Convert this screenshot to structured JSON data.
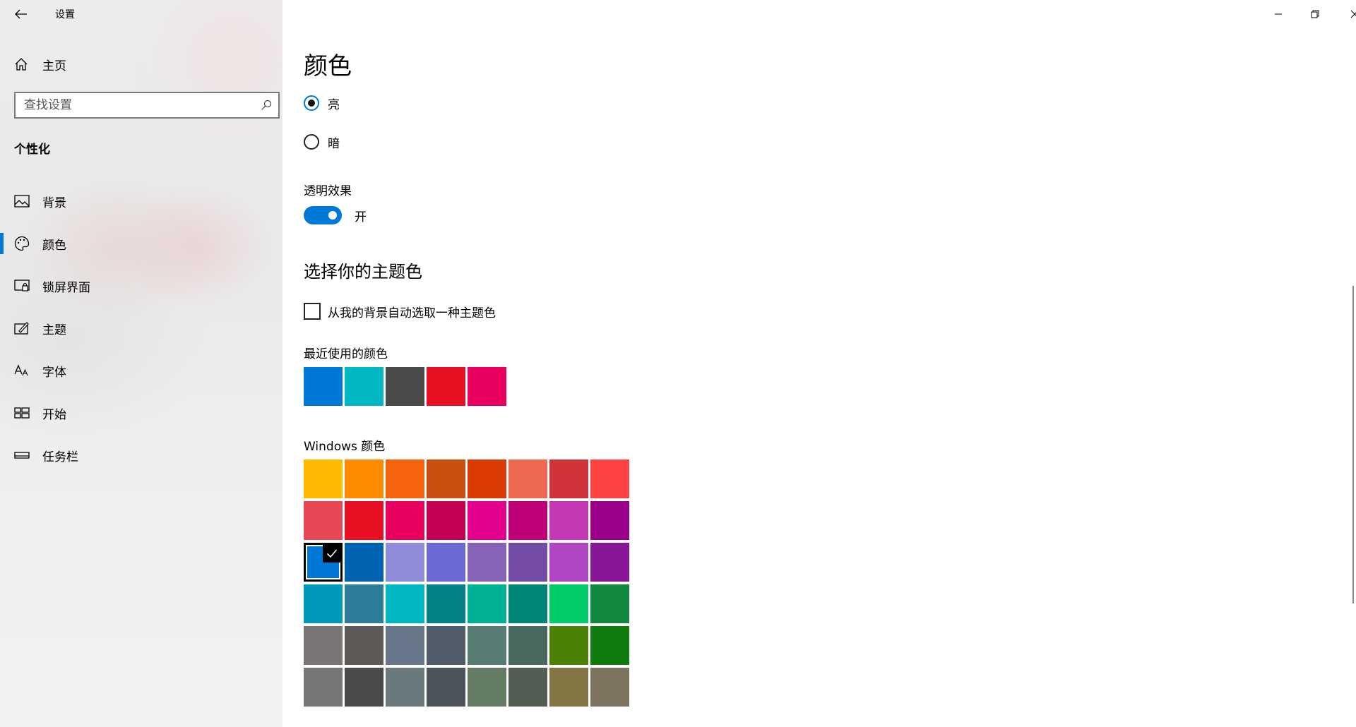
{
  "app": {
    "title": "设置"
  },
  "sidebar": {
    "home_label": "主页",
    "search_placeholder": "查找设置",
    "section_title": "个性化",
    "items": [
      {
        "label": "背景",
        "icon": "picture-icon"
      },
      {
        "label": "颜色",
        "icon": "palette-icon",
        "active": true
      },
      {
        "label": "锁屏界面",
        "icon": "lock-screen-icon"
      },
      {
        "label": "主题",
        "icon": "theme-brush-icon"
      },
      {
        "label": "字体",
        "icon": "font-icon"
      },
      {
        "label": "开始",
        "icon": "start-icon"
      },
      {
        "label": "任务栏",
        "icon": "taskbar-icon"
      }
    ]
  },
  "main": {
    "title": "颜色",
    "mode_options": [
      {
        "label": "亮",
        "checked": true
      },
      {
        "label": "暗",
        "checked": false
      }
    ],
    "transparency": {
      "label": "透明效果",
      "state_label": "开",
      "on": true
    },
    "accent": {
      "title": "选择你的主题色",
      "auto_pick_label": "从我的背景自动选取一种主题色",
      "auto_pick_checked": false,
      "recent_label": "最近使用的颜色",
      "recent_colors": [
        "#0078d7",
        "#00b7c3",
        "#4c4a48",
        "#e81123",
        "#ea005e"
      ],
      "windows_label": "Windows 颜色",
      "selected_index": 16,
      "windows_colors": [
        "#ffb900",
        "#ff8c00",
        "#f7630c",
        "#ca5010",
        "#da3b01",
        "#ef6950",
        "#d13438",
        "#ff4343",
        "#e74856",
        "#e81123",
        "#ea005e",
        "#c30052",
        "#e3008c",
        "#bf0077",
        "#c239b3",
        "#9a0089",
        "#0078d7",
        "#0063b1",
        "#8e8cd8",
        "#6b69d6",
        "#8764b8",
        "#744da9",
        "#b146c2",
        "#881798",
        "#0099bc",
        "#2d7d9a",
        "#00b7c3",
        "#038387",
        "#00b294",
        "#018574",
        "#00cc6a",
        "#10893e",
        "#7a7574",
        "#5d5a58",
        "#68768a",
        "#515c6b",
        "#567c73",
        "#486860",
        "#498205",
        "#107c10",
        "#767676",
        "#4c4a48",
        "#69797e",
        "#4a5459",
        "#647c64",
        "#525e54",
        "#847545",
        "#7e735f"
      ]
    }
  }
}
